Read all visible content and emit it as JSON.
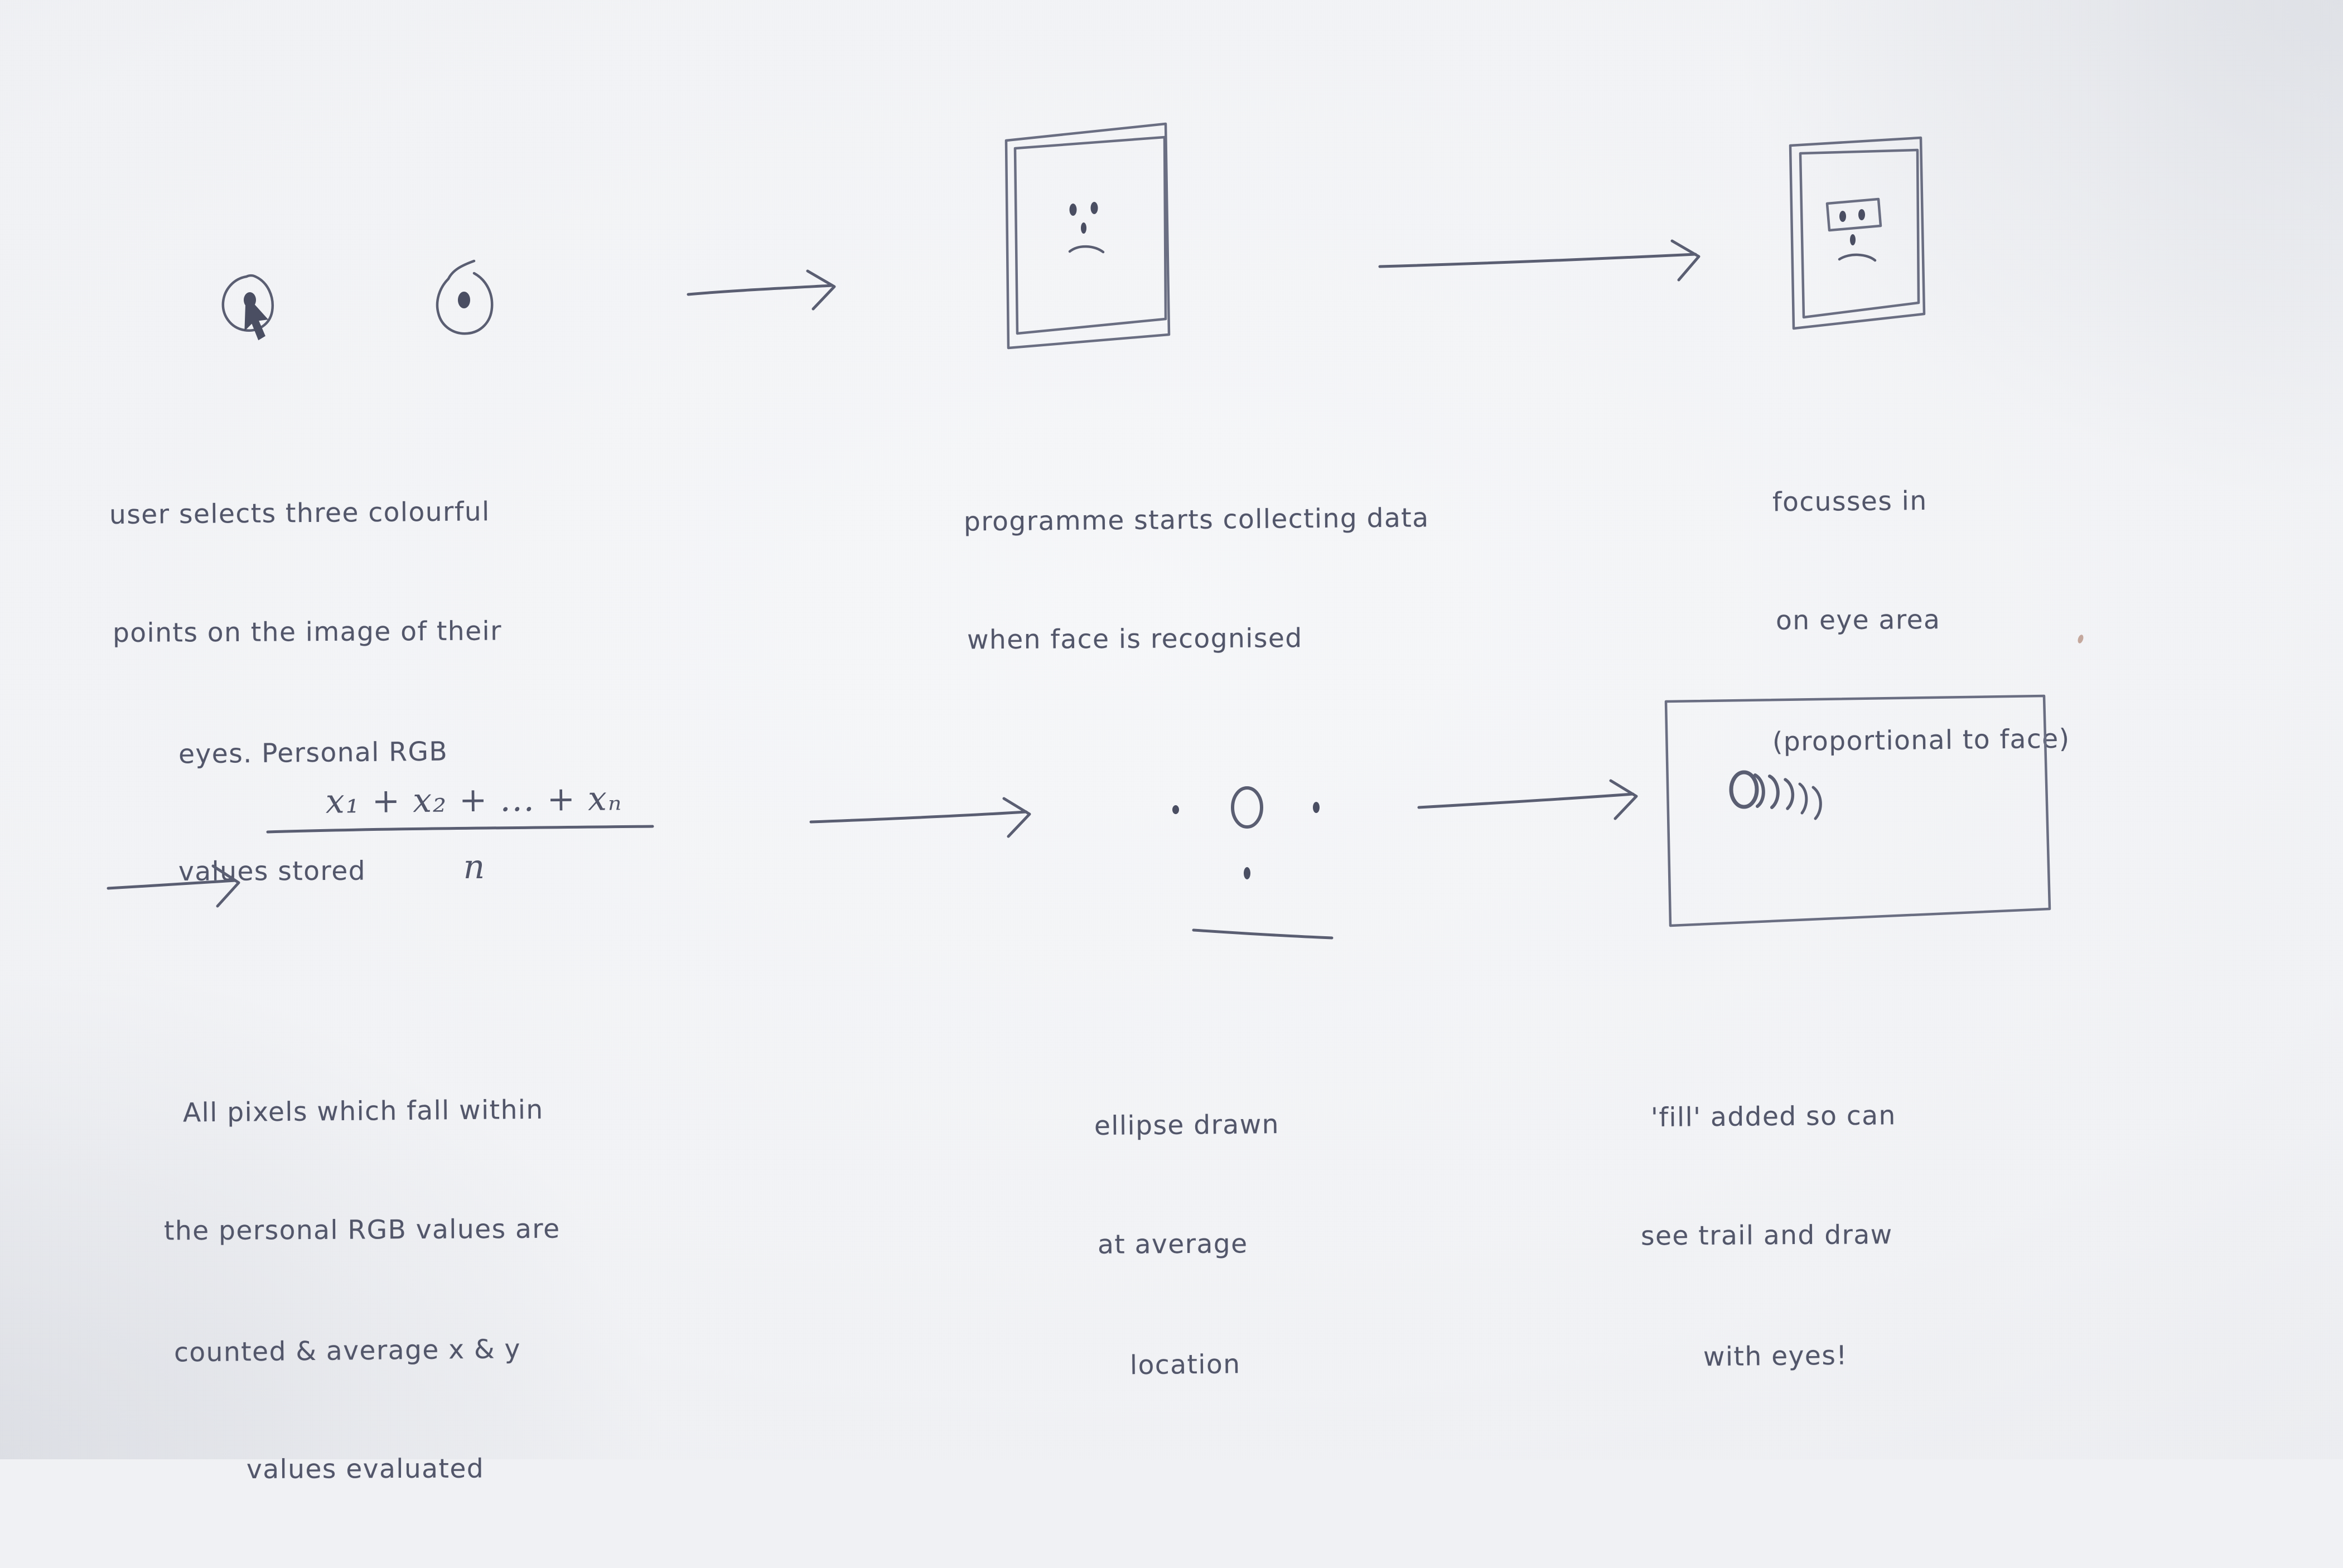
{
  "document": {
    "kind": "handwritten-sketch-notes",
    "subject": "Eye-tracking drawing programme — process flow",
    "ink_color": "#5a5e72",
    "paper_color": "#f0f1f4"
  },
  "panels": [
    {
      "id": "panel-1",
      "step": 1,
      "sketch": "two-eyes-with-cursor",
      "sketch_parts": [
        "left-eye",
        "left-eye-pupil",
        "cursor-pointer",
        "right-eye",
        "right-eye-pupil"
      ],
      "caption_lines": [
        "user selects three colourful",
        "points on the image of their",
        "eyes. Personal RGB",
        "values stored"
      ]
    },
    {
      "id": "panel-2",
      "step": 2,
      "sketch": "camera-frame-with-face",
      "sketch_parts": [
        "double-rectangle-frame",
        "eye-dot-left",
        "eye-dot-right",
        "nose-dash",
        "frown-mouth"
      ],
      "caption_lines": [
        "programme starts collecting data",
        "when face is recognised"
      ]
    },
    {
      "id": "panel-3",
      "step": 3,
      "sketch": "camera-frame-with-eye-region-box",
      "sketch_parts": [
        "double-rectangle-frame",
        "eye-area-box",
        "eye-dot-left",
        "eye-dot-right",
        "nose-dash",
        "frown-mouth"
      ],
      "caption_lines": [
        "focusses in",
        "on eye area",
        "(proportional to face)"
      ]
    },
    {
      "id": "panel-4",
      "step": 4,
      "sketch": "mean-formula",
      "formula": {
        "numerator": "x₁ + x₂ + ... + xₙ",
        "denominator": "n",
        "meaning": "arithmetic mean of matching pixel coordinates"
      },
      "caption_lines": [
        "All pixels which fall within",
        "the personal RGB values are",
        "counted & average x & y",
        "values evaluated"
      ]
    },
    {
      "id": "panel-5",
      "step": 5,
      "sketch": "ellipse-at-average-location",
      "sketch_parts": [
        "dot-left",
        "hollow-ellipse",
        "dot-right",
        "dot-below",
        "baseline-stroke"
      ],
      "caption_lines": [
        "ellipse drawn",
        "at average",
        "location"
      ]
    },
    {
      "id": "panel-6",
      "step": 6,
      "sketch": "canvas-with-ellipse-trail",
      "sketch_parts": [
        "single-rectangle-canvas",
        "filled-ellipse-head",
        "trail-arc-1",
        "trail-arc-2",
        "trail-arc-3",
        "trail-arc-4",
        "trail-arc-5"
      ],
      "caption_lines": [
        "'fill' added so can",
        "see trail and draw",
        "with eyes!"
      ]
    }
  ],
  "arrows": [
    {
      "id": "arrow-1",
      "from": "panel-1",
      "to": "panel-2",
      "direction": "right"
    },
    {
      "id": "arrow-2",
      "from": "panel-2",
      "to": "panel-3",
      "direction": "right"
    },
    {
      "id": "arrow-3",
      "from": "panel-3",
      "to": "panel-4",
      "direction": "right",
      "note": "wraps to second row"
    },
    {
      "id": "arrow-4",
      "from": "panel-4",
      "to": "panel-5",
      "direction": "right"
    },
    {
      "id": "arrow-5",
      "from": "panel-5",
      "to": "panel-6",
      "direction": "right"
    }
  ]
}
